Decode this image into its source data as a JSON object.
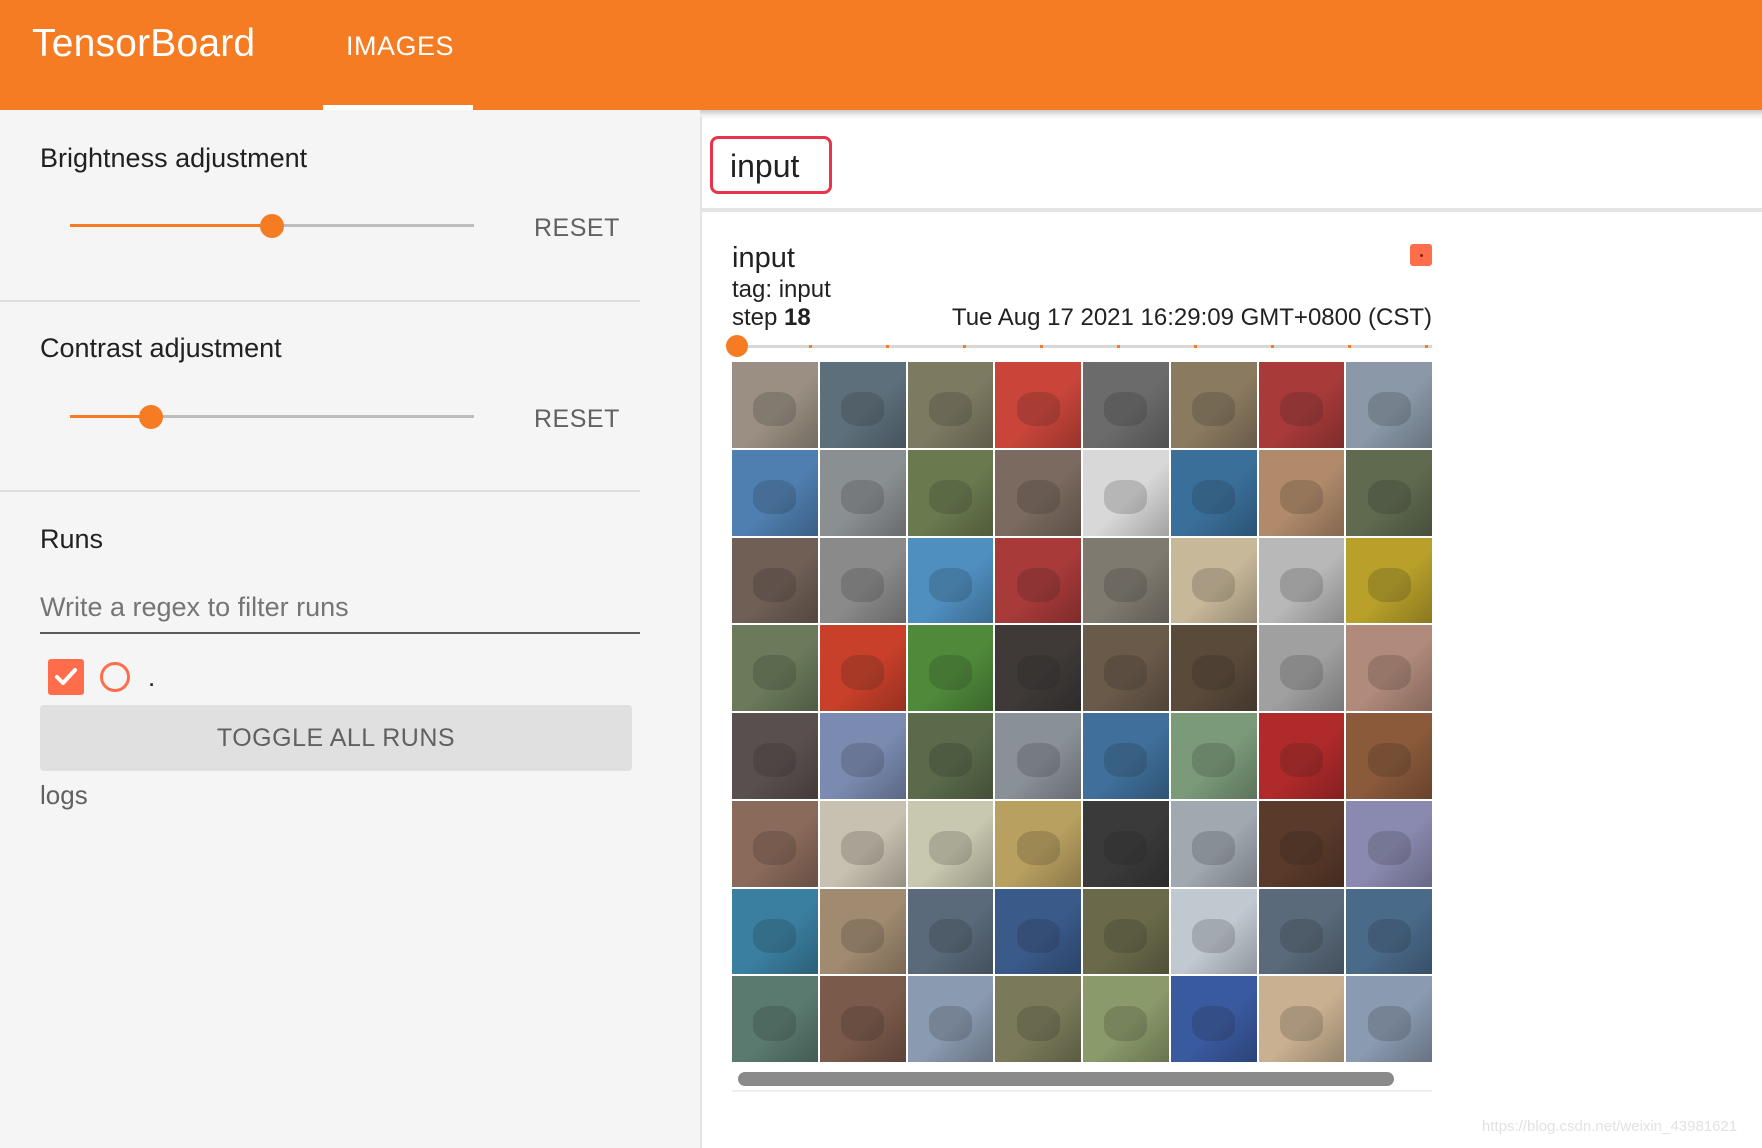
{
  "header": {
    "brand": "TensorBoard",
    "tabs": [
      {
        "label": "IMAGES",
        "active": true
      }
    ],
    "accent_color": "#f57c22"
  },
  "sidebar": {
    "brightness": {
      "title": "Brightness adjustment",
      "value": 0.5,
      "reset_label": "RESET"
    },
    "contrast": {
      "title": "Contrast adjustment",
      "value": 0.2,
      "reset_label": "RESET"
    },
    "runs": {
      "title": "Runs",
      "filter_placeholder": "Write a regex to filter runs",
      "items": [
        {
          "name": ".",
          "checked": true,
          "color": "#ff6d4a"
        }
      ],
      "toggle_label": "TOGGLE ALL RUNS",
      "logdir": "logs"
    }
  },
  "main": {
    "tag_filter": {
      "value": "input"
    },
    "card": {
      "title": "input",
      "tag_line": "tag: input",
      "step_label": "step",
      "step_value": "18",
      "timestamp": "Tue Aug 17 2021 16:29:09 GMT+0800 (CST)",
      "run_color": "#ff6d4a",
      "step_slider_position": 0.0,
      "image_grid": {
        "rows": 8,
        "cols": 8,
        "cells": [
          "#9a8f82",
          "#5d6f7a",
          "#7d7a62",
          "#c9453a",
          "#6b6b6b",
          "#8a7a60",
          "#a83a3a",
          "#8a98a8",
          "#4f7fb0",
          "#8a8f92",
          "#6a7a4f",
          "#7a6a5f",
          "#d8d8d8",
          "#3a6f9a",
          "#b08a6a",
          "#5f6a4f",
          "#6f5f55",
          "#8a8a8a",
          "#4f8fc0",
          "#a83a3a",
          "#7f7a70",
          "#c8b89a",
          "#b8b8b8",
          "#b8a02a",
          "#6a7a5a",
          "#c8402a",
          "#4f8a3a",
          "#3f3a38",
          "#6a5a4a",
          "#5a4a3a",
          "#a0a0a0",
          "#b08a7a",
          "#5a4f4f",
          "#7a8ab0",
          "#5a6a4a",
          "#8a9098",
          "#3f6f9a",
          "#7a9a7a",
          "#b02a2a",
          "#8a5a3a",
          "#8a6a5a",
          "#c8c0b0",
          "#c8c8b0",
          "#b8a060",
          "#3a3a3a",
          "#a0a8b0",
          "#5a3a2a",
          "#8a8ab0",
          "#3a7fa0",
          "#a08a70",
          "#5a6a7a",
          "#3a5a8a",
          "#6a6a4a",
          "#c0c8d0",
          "#5a6a7a",
          "#4a6a8a",
          "#5a7a70",
          "#7a5a4a",
          "#8a9ab0",
          "#7a7a5a",
          "#8a9a6a",
          "#3a5aa0",
          "#c8b090",
          "#8a9ab0"
        ]
      },
      "scrollbar_position": 0.0
    }
  },
  "watermark": "https://blog.csdn.net/weixin_43981621"
}
